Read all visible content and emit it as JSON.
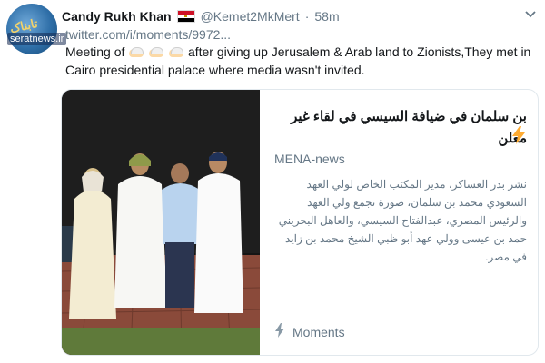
{
  "tweet": {
    "author_name": "Candy Rukh Khan",
    "handle": "@Kemet2MkMert",
    "separator": "·",
    "time": "58m",
    "link": "twitter.com/i/moments/9972...",
    "text_pre": "Meeting of",
    "text_post": "after giving up Jerusalem & Arab land to Zionists,They met in Cairo presidential palace where media wasn't invited.",
    "emoji_count": 3,
    "emoji_icon": "man-with-keffiyeh-emoji"
  },
  "avatar": {
    "logo_text": "تابناک",
    "watermark": "seratnews.ir"
  },
  "card": {
    "headline": "بن سلمان في ضيافة السيسي في لقاء غير معلن",
    "source": "MENA-news",
    "description": "نشر بدر العساكر، مدير المكتب الخاص لولي العهد السعودي محمد بن سلمان، صورة تجمع ولي العهد والرئيس المصري، عبدالفتاح السيسي، والعاهل البحريني حمد بن عيسى وولي عهد أبو ظبي الشيخ محمد بن زايد في مصر.",
    "footer_label": "Moments"
  },
  "colors": {
    "text": "#14171a",
    "muted": "#657786",
    "border": "#e1e8ed",
    "bolt": "#ffac33"
  }
}
